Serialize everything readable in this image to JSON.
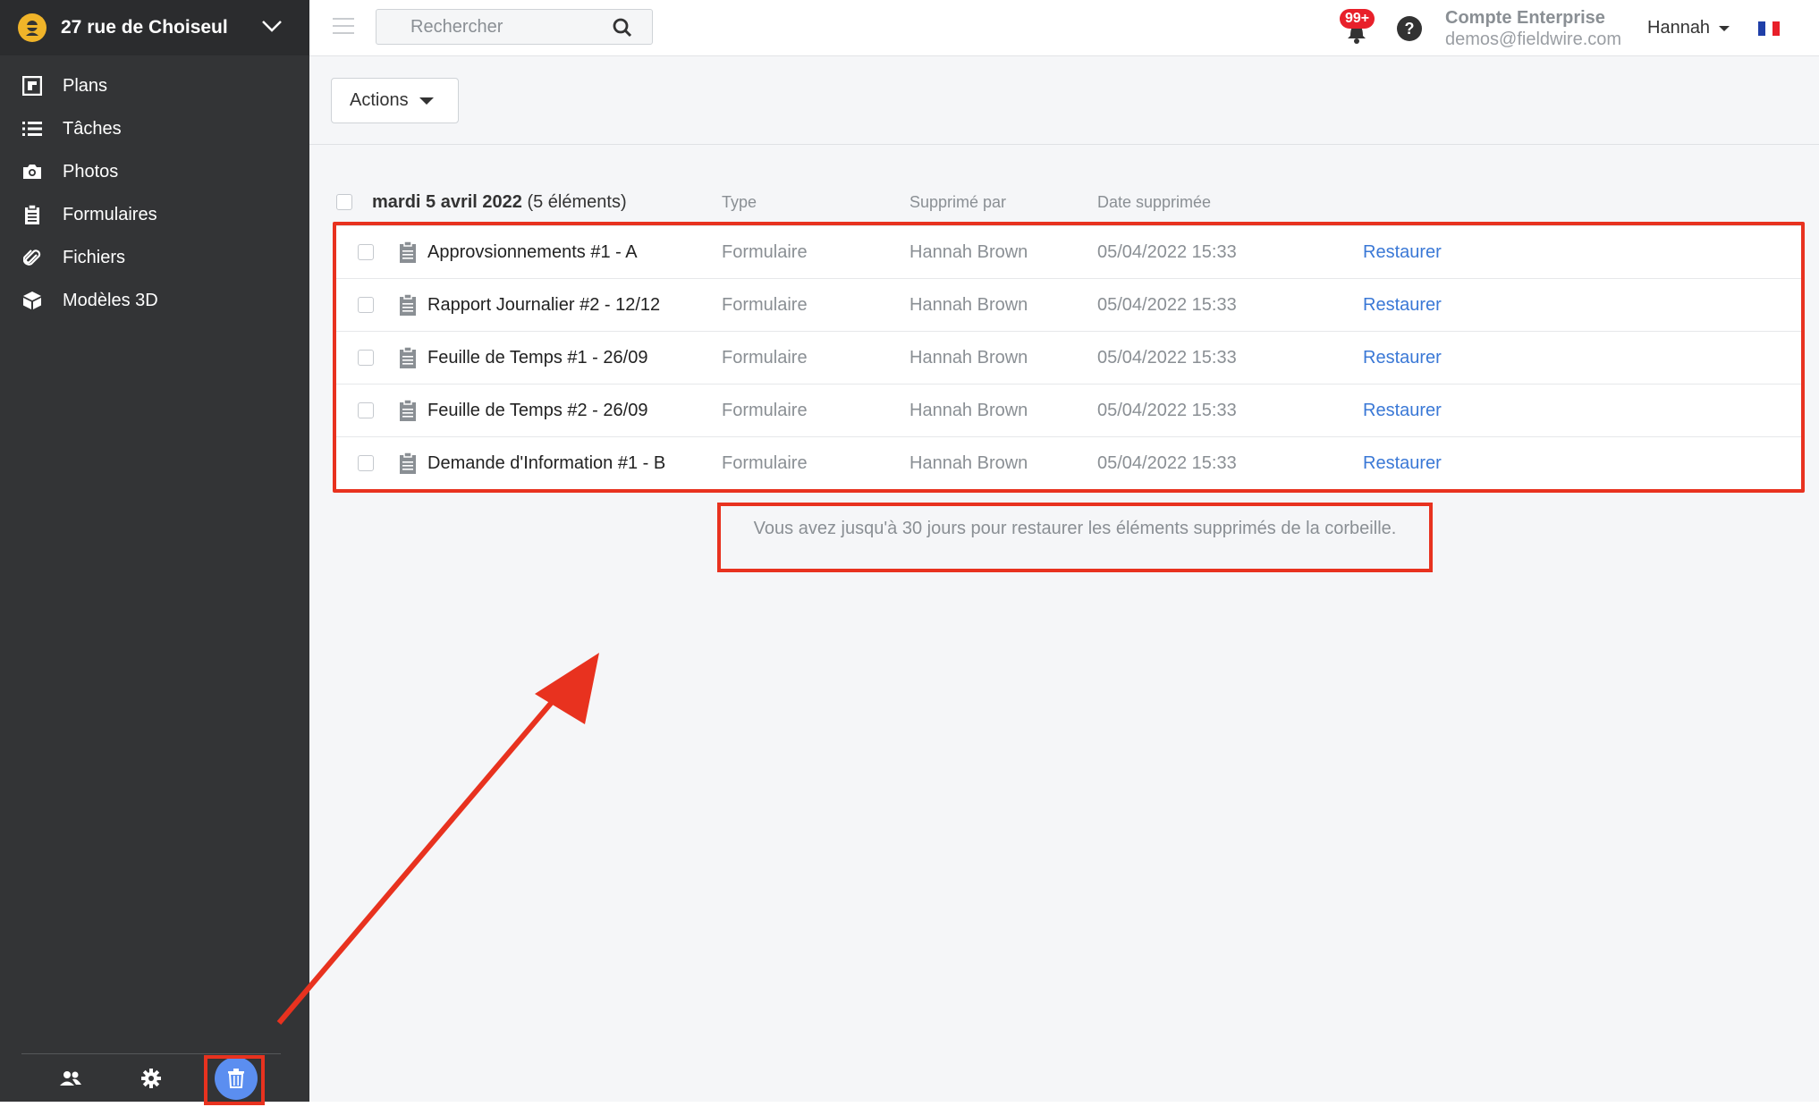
{
  "project": {
    "name": "27 rue de Choiseul"
  },
  "sidebar": {
    "items": [
      {
        "label": "Plans",
        "icon": "plans-icon"
      },
      {
        "label": "Tâches",
        "icon": "list-icon"
      },
      {
        "label": "Photos",
        "icon": "camera-icon"
      },
      {
        "label": "Formulaires",
        "icon": "clipboard-icon"
      },
      {
        "label": "Fichiers",
        "icon": "paperclip-icon"
      },
      {
        "label": "Modèles 3D",
        "icon": "cube-icon"
      }
    ],
    "footer": [
      "people-icon",
      "gear-icon",
      "trash-icon"
    ]
  },
  "topbar": {
    "search_placeholder": "Rechercher",
    "notifications_badge": "99+",
    "help_label": "?",
    "account_name": "Compte Enterprise",
    "account_email": "demos@fieldwire.com",
    "user_name": "Hannah",
    "flag_colors": [
      "#1f3fa8",
      "#ffffff",
      "#e8202a"
    ]
  },
  "main": {
    "actions_label": "Actions",
    "group": {
      "date": "mardi 5 avril 2022",
      "count": "(5 éléments)"
    },
    "columns": {
      "type": "Type",
      "deleted_by": "Supprimé par",
      "deleted_date": "Date supprimée"
    },
    "rows": [
      {
        "name": "Approvsionnements #1 - A",
        "type": "Formulaire",
        "deleted_by": "Hannah Brown",
        "date": "05/04/2022 15:33",
        "action": "Restaurer"
      },
      {
        "name": "Rapport Journalier #2 - 12/12",
        "type": "Formulaire",
        "deleted_by": "Hannah Brown",
        "date": "05/04/2022 15:33",
        "action": "Restaurer"
      },
      {
        "name": "Feuille de Temps #1 - 26/09",
        "type": "Formulaire",
        "deleted_by": "Hannah Brown",
        "date": "05/04/2022 15:33",
        "action": "Restaurer"
      },
      {
        "name": "Feuille de Temps #2 - 26/09",
        "type": "Formulaire",
        "deleted_by": "Hannah Brown",
        "date": "05/04/2022 15:33",
        "action": "Restaurer"
      },
      {
        "name": "Demande d'Information #1 - B",
        "type": "Formulaire",
        "deleted_by": "Hannah Brown",
        "date": "05/04/2022 15:33",
        "action": "Restaurer"
      }
    ],
    "notice": "Vous avez jusqu'à 30 jours pour restaurer les éléments supprimés de la corbeille."
  },
  "colors": {
    "accent": "#3a78d6",
    "highlight": "#e8321f",
    "sidebar": "#333436",
    "trash_button": "#5b8ef0"
  }
}
